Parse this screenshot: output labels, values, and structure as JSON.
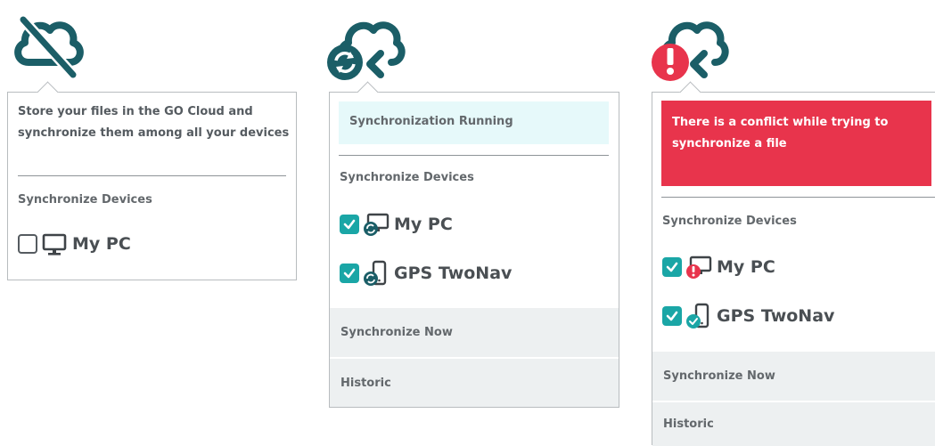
{
  "colors": {
    "teal": "#1b5e67",
    "accent_teal": "#1aa6a6",
    "alert_red": "#e8344c",
    "running_bg": "#e6f9fa"
  },
  "states": [
    {
      "name": "sync-disabled",
      "cloud_icon": "cloud-off-icon",
      "intro_lines": [
        "Store your files in the GO Cloud and",
        "synchronize them among all your devices"
      ],
      "section_label": "Synchronize Devices",
      "devices": [
        {
          "label": "My PC",
          "checked": false,
          "icon": "monitor-icon"
        }
      ]
    },
    {
      "name": "sync-running",
      "cloud_icon": "cloud-sync-icon",
      "status": "Synchronization Running",
      "section_label": "Synchronize Devices",
      "devices": [
        {
          "label": "My PC",
          "checked": true,
          "icon": "monitor-sync-icon"
        },
        {
          "label": "GPS TwoNav",
          "checked": true,
          "icon": "phone-sync-icon"
        }
      ],
      "actions": [
        "Synchronize Now",
        "Historic"
      ]
    },
    {
      "name": "sync-conflict",
      "cloud_icon": "cloud-alert-icon",
      "status_lines": [
        "There is a conflict while trying to",
        "synchronize a file"
      ],
      "section_label": "Synchronize Devices",
      "devices": [
        {
          "label": "My PC",
          "checked": true,
          "icon": "monitor-alert-icon"
        },
        {
          "label": "GPS TwoNav",
          "checked": true,
          "icon": "phone-ok-icon"
        }
      ],
      "actions": [
        "Synchronize Now",
        "Historic"
      ]
    }
  ]
}
